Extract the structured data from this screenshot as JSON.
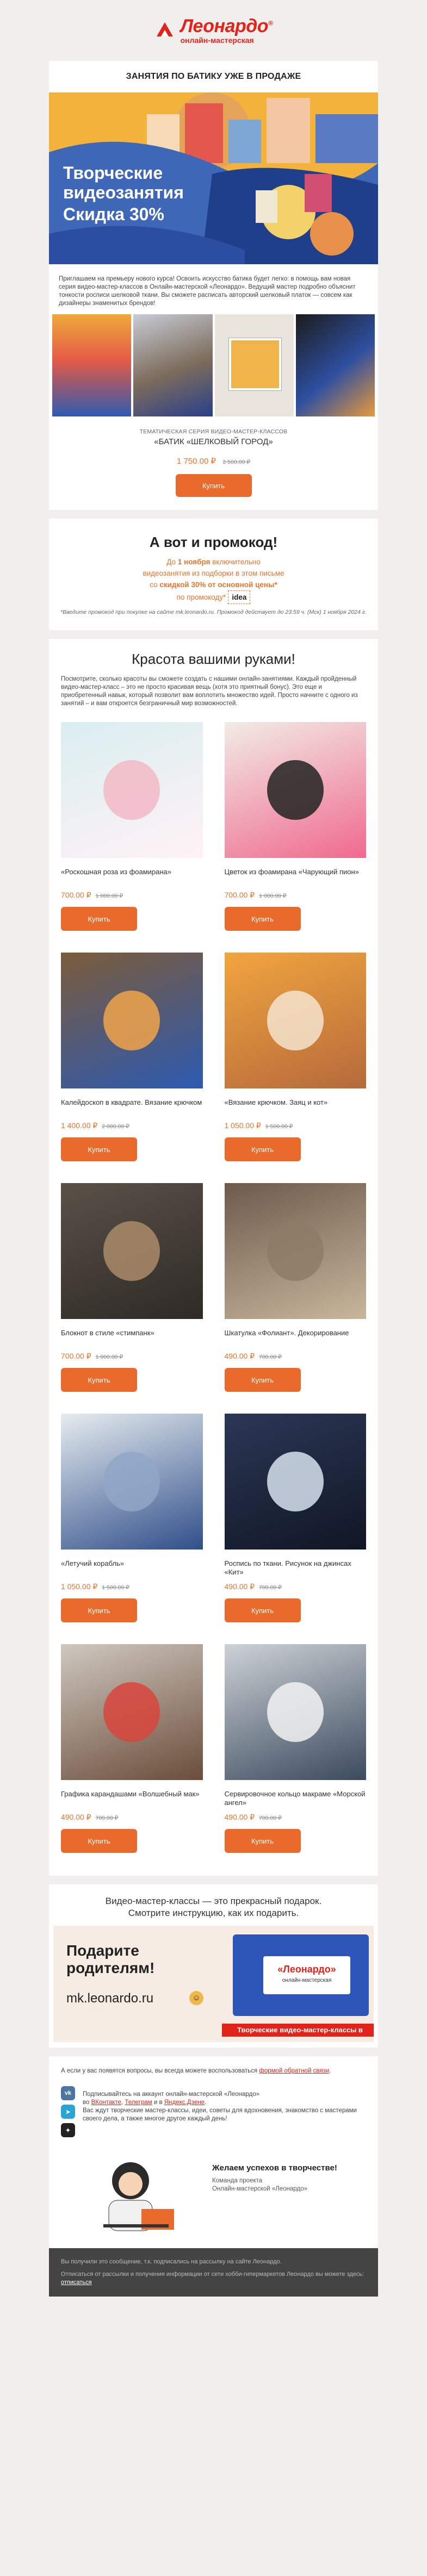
{
  "header": {
    "brand": "Леонардо",
    "reg": "®",
    "subtitle": "онлайн-мастерская"
  },
  "hero": {
    "title": "ЗАНЯТИЯ ПО БАТИКУ УЖЕ В ПРОДАЖЕ",
    "banner_line1": "Творческие",
    "banner_line2": "видеозанятия",
    "banner_line3": "Скидка 30%",
    "intro": "Приглашаем на премьеру нового курса! Освоить искусство батика будет легко: в помощь вам новая серия видео-мастер-классов в Онлайн-мастерской «Леонардо». Ведущий мастер подробно объяснит тонкости росписи шелковой ткани. Вы сможете расписать авторский шелковый платок — совсем как дизайнеры знаменитых брендов!",
    "series_label": "ТЕМАТИЧЕСКАЯ СЕРИЯ ВИДЕО-МАСТЕР-КЛАССОВ",
    "series_name": "«БАТИК «ШЕЛКОВЫЙ ГОРОД»",
    "price": "1 750.00 ₽",
    "old_price": "2 500.00 ₽",
    "buy": "Купить"
  },
  "promo": {
    "title": "А вот и промокод!",
    "line1_pre": "До ",
    "line1_bold": "1 ноября",
    "line1_post": " включительно",
    "line2": "видеозанятия из подборки в этом письме",
    "line3_pre": "со ",
    "line3_bold": "скидкой 30% от основной цены*",
    "line4": "по промокоду*",
    "code": "idea",
    "note": "*Введите промокод при покупке на сайте mk.leonardo.ru. Промокод действует до 23:59 ч. (Мск) 1 ноября 2024 г."
  },
  "collection": {
    "title": "Красота вашими руками!",
    "text": "Посмотрите, сколько красоты вы сможете создать с нашими онлайн-занятиями. Каждый пройденный видео-мастер-класс – это не просто красивая вещь (хотя это приятный бонус). Это еще и приобретенный навык, который позволит вам воплотить множество идей. Просто начните с одного из занятий – и вам откроется безграничный мир возможностей.",
    "buy": "Купить",
    "products": [
      {
        "name": "«Роскошная роза из фоамирана»",
        "price": "700.00 ₽",
        "old": "1 000.00 ₽"
      },
      {
        "name": "Цветок из фоамирана «Чарующий пион»",
        "price": "700.00 ₽",
        "old": "1 000.00 ₽"
      },
      {
        "name": "Калейдоскоп в квадрате. Вязание крючком",
        "price": "1 400.00 ₽",
        "old": "2 000.00 ₽"
      },
      {
        "name": "«Вязание крючком. Заяц и кот»",
        "price": "1 050.00 ₽",
        "old": "1 500.00 ₽"
      },
      {
        "name": "Блокнот в стиле «стимпанк»",
        "price": "700.00 ₽",
        "old": "1 000.00 ₽"
      },
      {
        "name": "Шкатулка «Фолиант». Декорирование",
        "price": "490.00 ₽",
        "old": "700.00 ₽"
      },
      {
        "name": "«Летучий корабль»",
        "price": "1 050.00 ₽",
        "old": "1 500.00 ₽"
      },
      {
        "name": "Роспись по ткани. Рисунок на джинсах «Кит»",
        "price": "490.00 ₽",
        "old": "700.00 ₽"
      },
      {
        "name": "Графика карандашами «Волшебный мак»",
        "price": "490.00 ₽",
        "old": "700.00 ₽"
      },
      {
        "name": "Сервировочное кольцо макраме «Морской ангел»",
        "price": "490.00 ₽",
        "old": "700.00 ₽"
      }
    ]
  },
  "gift": {
    "head1": "Видео-мастер-классы — это прекрасный подарок.",
    "head2": "Смотрите инструкцию, как их подарить.",
    "banner_line1": "Подарите",
    "banner_line2": "родителям!",
    "site": "mk.leonardo.ru",
    "tag": "Творческие видео-мастер-классы в подарок",
    "cert_brand": "«Леонардо»",
    "cert_sub": "онлайн-мастерская"
  },
  "help": {
    "text": "А если у вас появятся вопросы, вы всегда можете воспользоваться ",
    "link": "формой обратной связи",
    "end": "."
  },
  "social": {
    "line1": "Подписывайтесь на аккаунт онлайн-мастерской «Леонардо»",
    "pre": "во ",
    "vk": "ВКонтакте",
    "mid1": ", ",
    "tg": "Телеграм",
    "mid2": " и в ",
    "dzen": "Яндекс.Дзене",
    "end": ".",
    "line2": "Вас ждут творческие мастер-классы, идеи, советы для вдохновения, знакомство с мастерами своего дела, а также многое другое каждый день!",
    "icons": [
      "vk-icon",
      "telegram-icon",
      "dzen-icon"
    ]
  },
  "wish": {
    "title": "Желаем успехов в творчестве!",
    "sign1": "Команда проекта",
    "sign2": "Онлайн-мастерской «Леонардо»"
  },
  "footer": {
    "line1": "Вы получили это сообщение, т.к. подписались на рассылку на сайте Леонардо.",
    "line2_pre": "Отписаться от рассылки и получения информации от сети хобби-гипермаркетов Леонардо вы можете здесь: ",
    "unsub": "отписаться"
  },
  "colors": {
    "brand_red": "#e2231a",
    "accent_orange": "#ea6a2c",
    "bg": "#f0efee"
  }
}
